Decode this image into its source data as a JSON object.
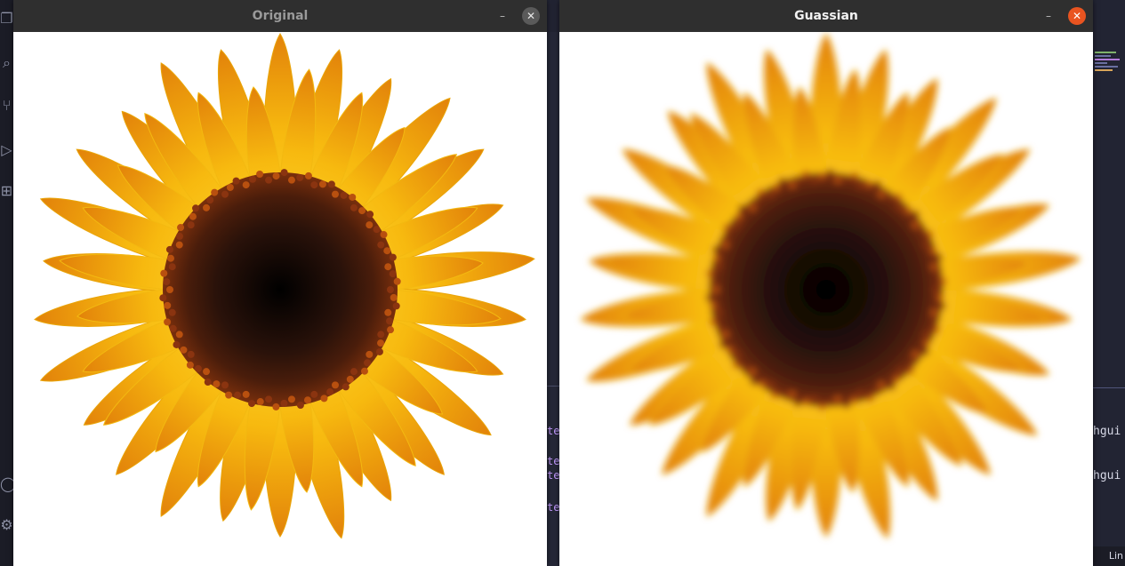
{
  "windows": {
    "original": {
      "title": "Original",
      "minimize_glyph": "–",
      "close_glyph": "✕"
    },
    "gaussian": {
      "title": "Guassian",
      "minimize_glyph": "–",
      "close_glyph": "✕"
    }
  },
  "image": {
    "subject": "sunflower",
    "petal_color": "#f7b90f",
    "center_color": "#2a120a",
    "ring_color": "#7a2f0c"
  },
  "background_editor": {
    "code_fragments": [
      "te",
      "te",
      "te",
      "te"
    ],
    "terminal_lines": [
      "hgui",
      "hgui"
    ],
    "status_text": "Lin"
  },
  "colors": {
    "titlebar": "#2f2f2f",
    "close_active": "#e95420",
    "close_inactive": "#5a5a5a"
  },
  "icons": [
    "explorer-icon",
    "search-icon",
    "source-control-icon",
    "run-debug-icon",
    "extensions-icon",
    "account-icon",
    "settings-icon"
  ]
}
